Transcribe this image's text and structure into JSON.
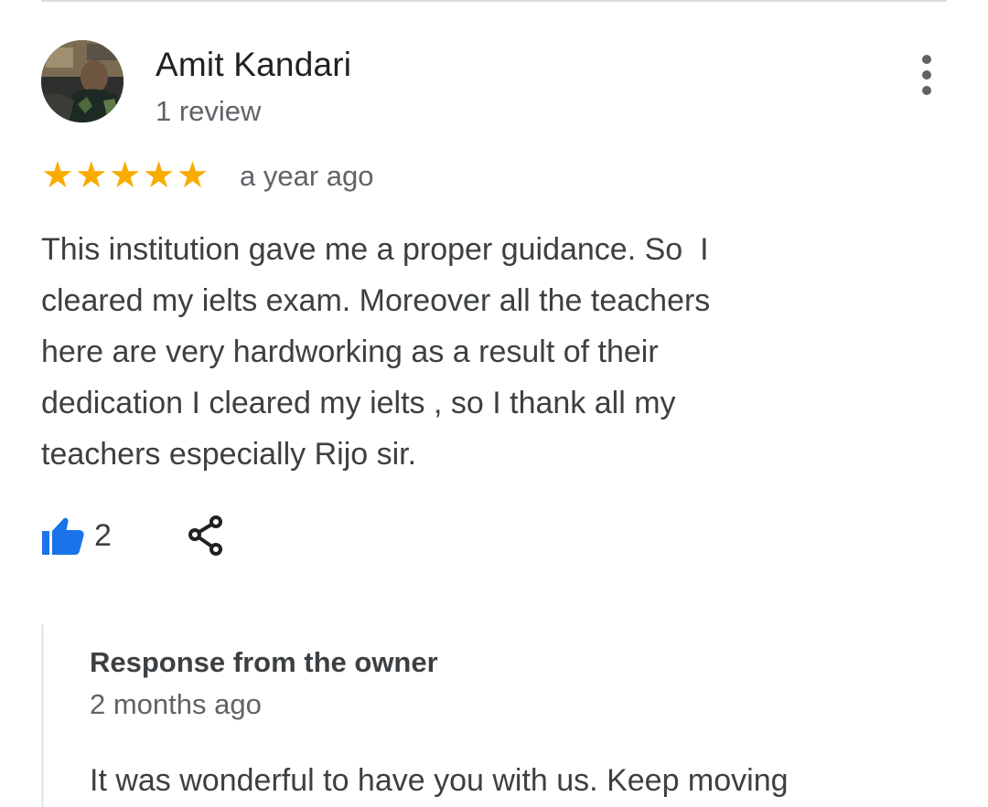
{
  "review": {
    "author_name": "Amit Kandari",
    "author_meta": "1 review",
    "rating": 5,
    "rating_stars": [
      "★",
      "★",
      "★",
      "★",
      "★"
    ],
    "date": "a year ago",
    "text": "This institution gave me a proper guidance. So  I\ncleared my ielts exam. Moreover all the teachers\nhere are very hardworking as a result of their\ndedication I cleared my ielts , so I thank all my\nteachers especially Rijo sir.",
    "likes": "2"
  },
  "owner_response": {
    "title": "Response from the owner",
    "date": "2 months ago",
    "text_partial": "It was wonderful to have you with us. Keep moving"
  },
  "icons": {
    "more": "more-vert-icon",
    "like": "thumb-up-icon",
    "share": "share-icon"
  },
  "colors": {
    "star": "#f9ab00",
    "like": "#1a73e8",
    "text_primary": "#202124",
    "text_secondary": "#5f6368"
  }
}
